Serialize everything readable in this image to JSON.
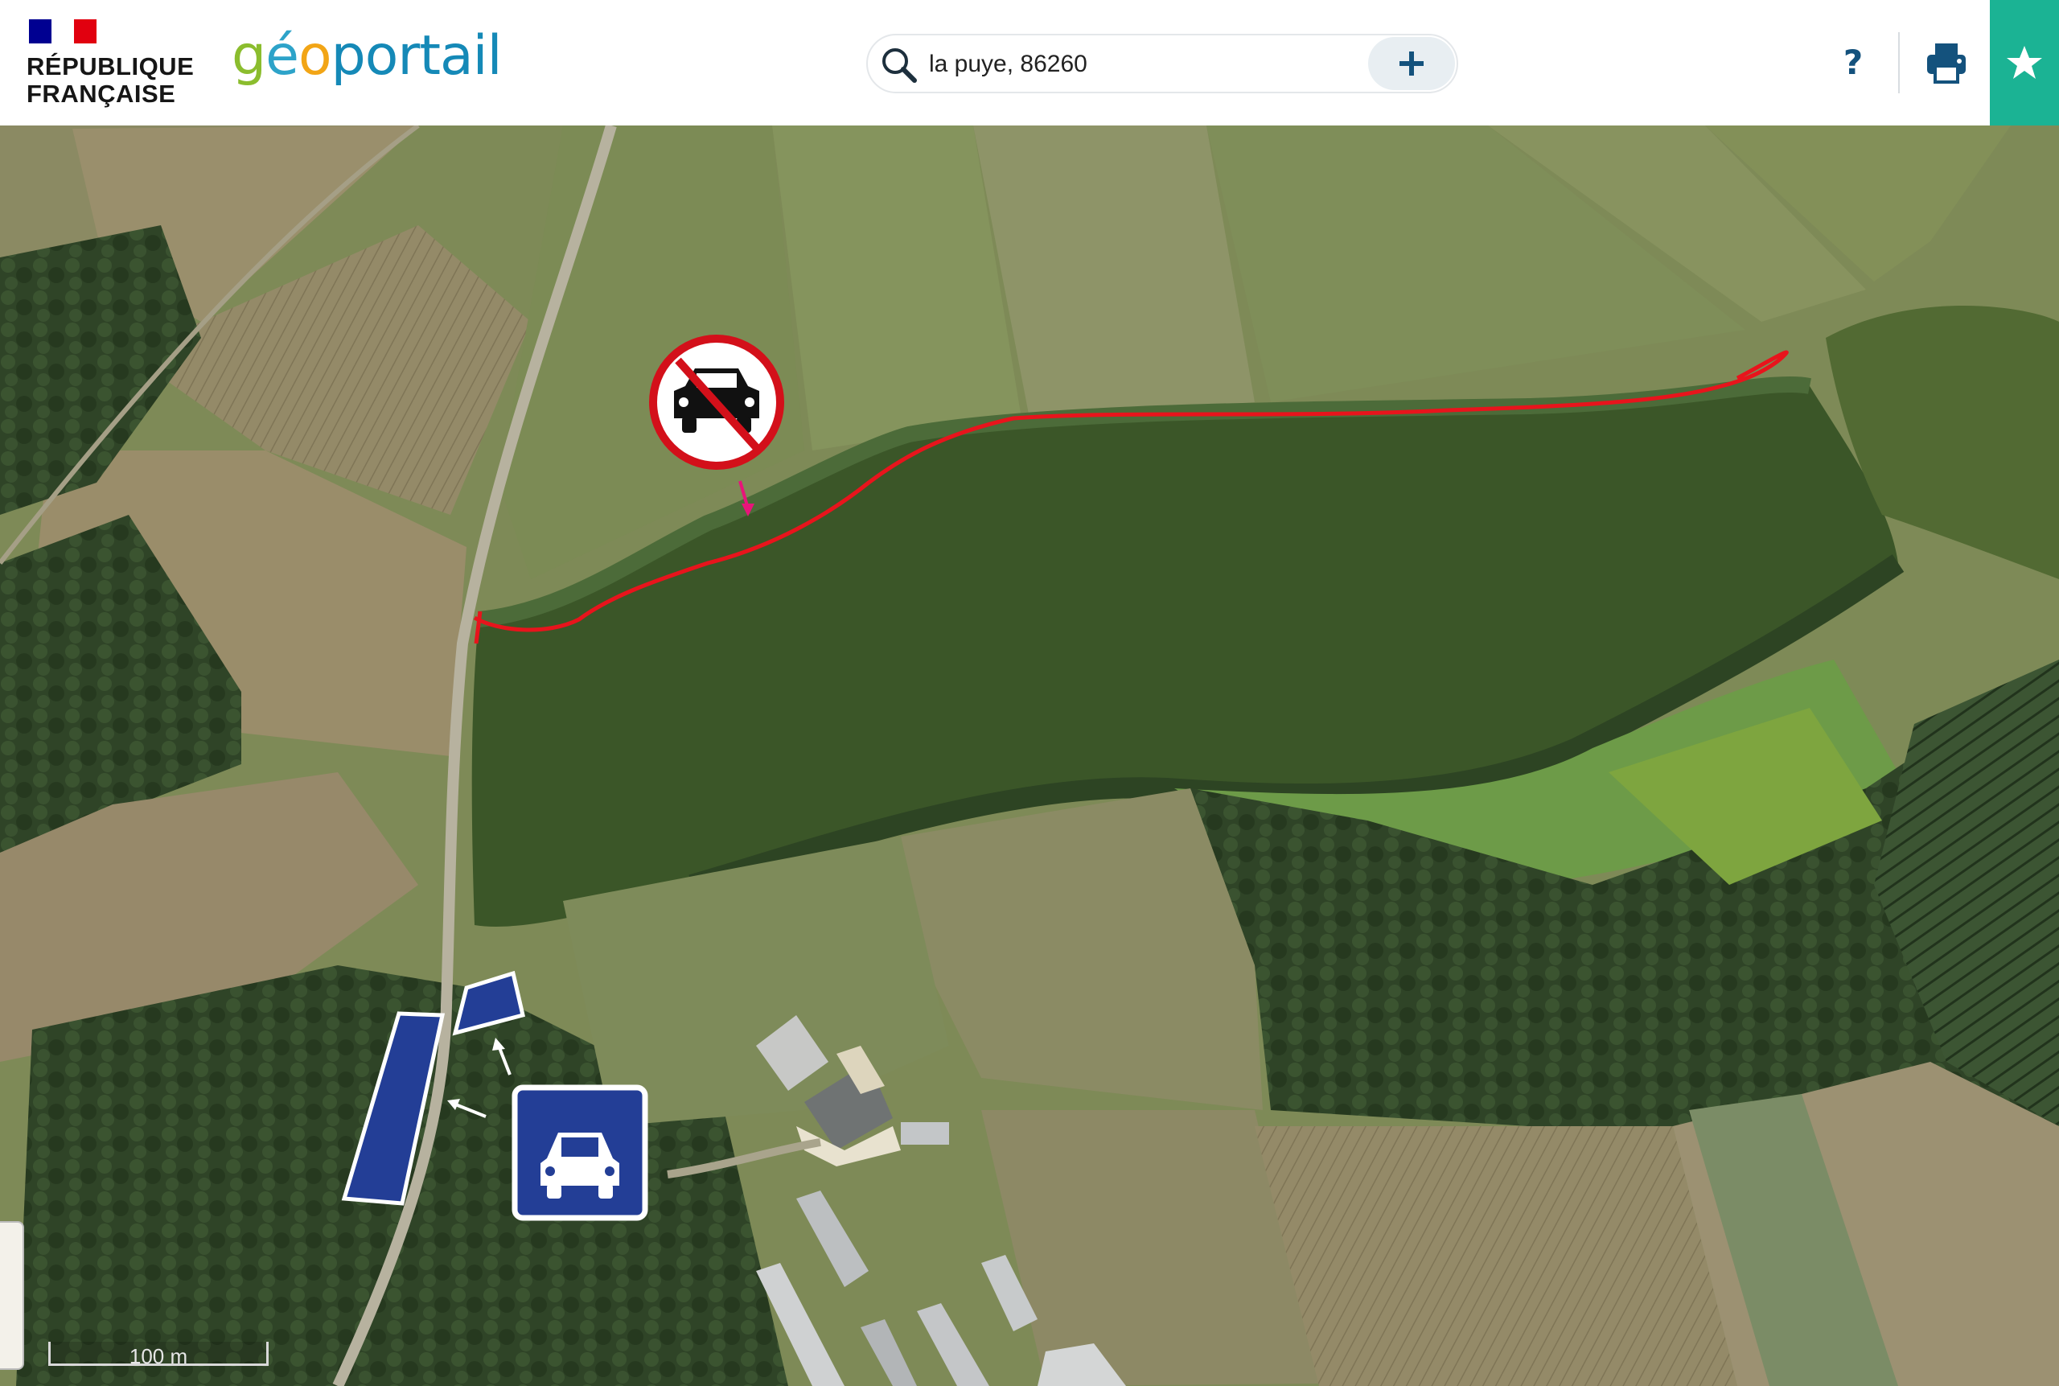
{
  "header": {
    "rf_flag_colors": [
      "#000091",
      "#ffffff",
      "#e1000f"
    ],
    "rf_line1": "RÉPUBLIQUE",
    "rf_line2": "FRANÇAISE",
    "logo": {
      "g": "g",
      "e": "é",
      "o": "o",
      "rest": "portail"
    },
    "logo_colors": {
      "g": "#8bbd2e",
      "e": "#2da3c9",
      "o": "#f2a516",
      "rest": "#1589b7"
    },
    "help_label": "?",
    "favorite_color": "#1bb394"
  },
  "search": {
    "value": "la puye, 86260",
    "icon": "magnifier-icon",
    "add_icon": "plus-icon"
  },
  "map": {
    "imagery": "aerial-photo",
    "scale_label": "100 m",
    "annotations": {
      "route_color": "#e8141c",
      "no_cars_sign": "no-motor-vehicles-sign",
      "parking_sign": "car-road-sign",
      "parking_color": "#233e96"
    }
  },
  "toolbar": {
    "help": "help-icon",
    "print": "printer-icon",
    "favorite": "star-icon"
  }
}
